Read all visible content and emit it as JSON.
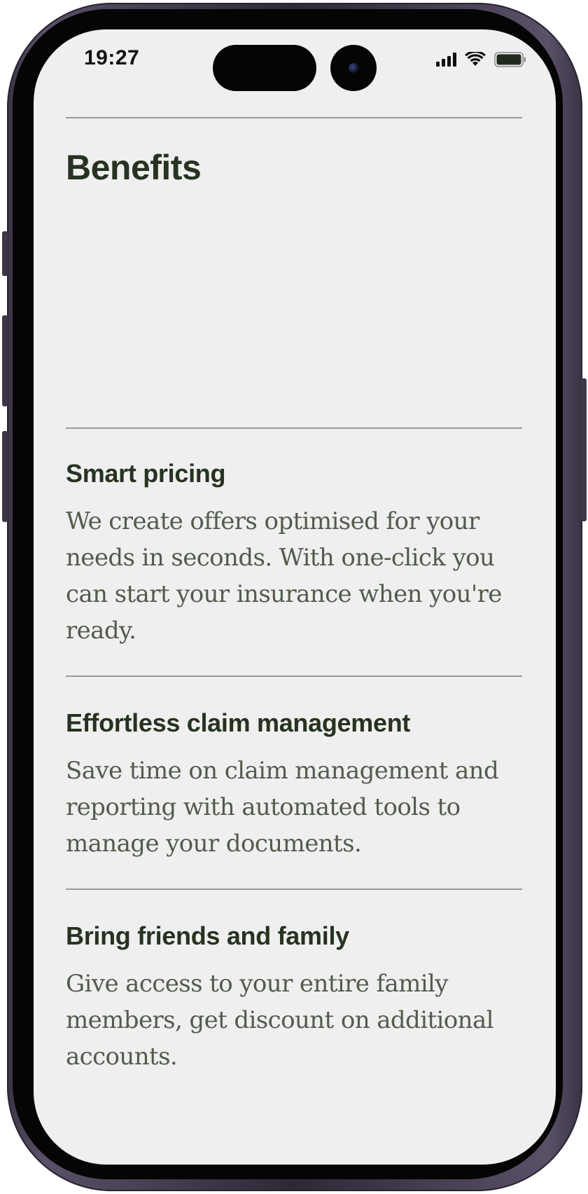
{
  "status_bar": {
    "time": "19:27",
    "icons": [
      "cellular-signal-icon",
      "wifi-icon",
      "battery-icon"
    ]
  },
  "page": {
    "title": "Benefits"
  },
  "benefits": [
    {
      "title": "Smart pricing",
      "text": "We create offers optimised for your needs in seconds. With one-click you can start your insurance when you're ready."
    },
    {
      "title": "Effortless claim management",
      "text": "Save time on claim management and reporting with automated tools to manage your documents."
    },
    {
      "title": "Bring friends and family",
      "text": "Give access to your entire family members, get discount on additional accounts."
    }
  ],
  "colors": {
    "background": "#efefef",
    "heading": "#273221",
    "body_text": "#525b4e",
    "divider": "#9a9a9a"
  }
}
